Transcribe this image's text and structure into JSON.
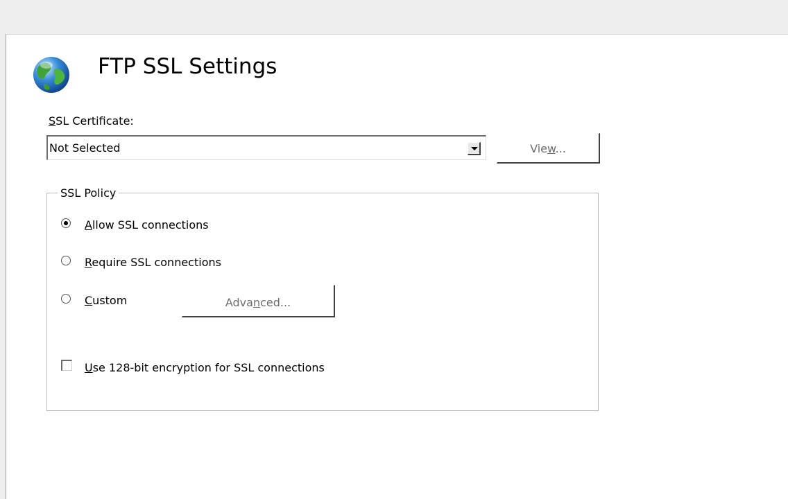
{
  "page": {
    "title": "FTP SSL Settings"
  },
  "certificate": {
    "label_mnemonic": "S",
    "label_rest": "SL Certificate:",
    "selected_value": "Not Selected",
    "view_button": {
      "before": "Vie",
      "mnemonic": "w",
      "after": "..."
    }
  },
  "policy": {
    "legend": "SSL Policy",
    "options": [
      {
        "mnemonic": "A",
        "rest": "llow SSL connections",
        "selected": true
      },
      {
        "mnemonic": "R",
        "rest": "equire SSL connections",
        "selected": false
      },
      {
        "mnemonic": "C",
        "rest": "ustom",
        "selected": false
      }
    ],
    "advanced_button": {
      "before": "Adva",
      "mnemonic": "n",
      "after": "ced..."
    },
    "encryption_checkbox": {
      "mnemonic": "U",
      "rest": "se 128-bit encryption for SSL connections",
      "checked": false
    }
  },
  "colors": {
    "chrome_background": "#eeeeee",
    "disabled_text": "#6d6d6d",
    "group_border": "#b9b9b9"
  },
  "icons": {
    "page_icon": "globe-icon",
    "dropdown_arrow": "dropdown-arrow-icon"
  }
}
